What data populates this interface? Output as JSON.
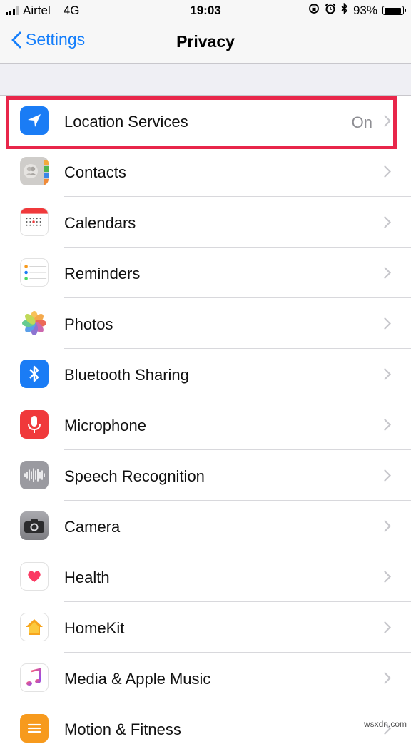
{
  "status_bar": {
    "carrier": "Airtel",
    "network": "4G",
    "time": "19:03",
    "battery_percent": "93%",
    "battery_level": 0.93,
    "icons": [
      "signal-icon",
      "rotation-lock-icon",
      "alarm-icon",
      "bluetooth-icon",
      "battery-icon"
    ]
  },
  "nav": {
    "back_label": "Settings",
    "title": "Privacy"
  },
  "rows": [
    {
      "label": "Location Services",
      "value": "On",
      "icon": "location-arrow-icon",
      "color": "#1a7cf5"
    },
    {
      "label": "Contacts",
      "value": "",
      "icon": "contacts-icon",
      "color": "#c9c7c4"
    },
    {
      "label": "Calendars",
      "value": "",
      "icon": "calendar-icon",
      "color": "#ffffff"
    },
    {
      "label": "Reminders",
      "value": "",
      "icon": "reminders-icon",
      "color": "#ffffff"
    },
    {
      "label": "Photos",
      "value": "",
      "icon": "photos-icon",
      "color": "#ffffff"
    },
    {
      "label": "Bluetooth Sharing",
      "value": "",
      "icon": "bluetooth-icon",
      "color": "#1a7cf5"
    },
    {
      "label": "Microphone",
      "value": "",
      "icon": "microphone-icon",
      "color": "#f0393b"
    },
    {
      "label": "Speech Recognition",
      "value": "",
      "icon": "waveform-icon",
      "color": "#9a9aa0"
    },
    {
      "label": "Camera",
      "value": "",
      "icon": "camera-icon",
      "color": "#8e8e93"
    },
    {
      "label": "Health",
      "value": "",
      "icon": "heart-icon",
      "color": "#ffffff"
    },
    {
      "label": "HomeKit",
      "value": "",
      "icon": "home-icon",
      "color": "#ffffff"
    },
    {
      "label": "Media & Apple Music",
      "value": "",
      "icon": "music-note-icon",
      "color": "#ffffff"
    },
    {
      "label": "Motion & Fitness",
      "value": "",
      "icon": "motion-icon",
      "color": "#f79a1d"
    }
  ],
  "highlight_color": "#e8264a",
  "watermark": "wsxdn.com"
}
